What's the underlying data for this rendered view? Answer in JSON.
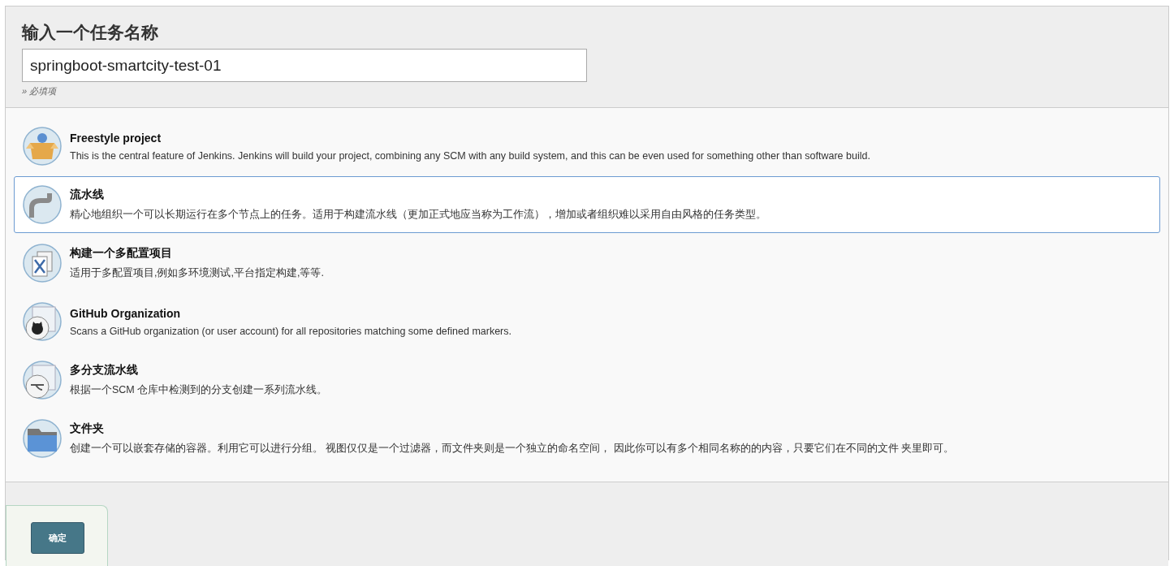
{
  "heading": "输入一个任务名称",
  "name_field": {
    "value": "springboot-smartcity-test-01"
  },
  "hint": "» 必填项",
  "items": [
    {
      "kind": "box",
      "title": "Freestyle project",
      "description": "This is the central feature of Jenkins. Jenkins will build your project, combining any SCM with any build system, and this can be even used for something other than software build.",
      "selected": false
    },
    {
      "kind": "pipe",
      "title": "流水线",
      "description": "精心地组织一个可以长期运行在多个节点上的任务。适用于构建流水线（更加正式地应当称为工作流），增加或者组织难以采用自由风格的任务类型。",
      "selected": true
    },
    {
      "kind": "tools",
      "title": "构建一个多配置项目",
      "description": "适用于多配置项目,例如多环境测试,平台指定构建,等等.",
      "selected": false
    },
    {
      "kind": "github",
      "title": "GitHub Organization",
      "description": "Scans a GitHub organization (or user account) for all repositories matching some defined markers.",
      "selected": false
    },
    {
      "kind": "branch",
      "title": "多分支流水线",
      "description": "根据一个SCM 仓库中检测到的分支创建一系列流水线。",
      "selected": false
    },
    {
      "kind": "folder",
      "title": "文件夹",
      "description": "创建一个可以嵌套存储的容器。利用它可以进行分组。 视图仅仅是一个过滤器，而文件夹则是一个独立的命名空间， 因此你可以有多个相同名称的的内容，只要它们在不同的文件 夹里即可。",
      "selected": false
    }
  ],
  "ok_button": "确定"
}
